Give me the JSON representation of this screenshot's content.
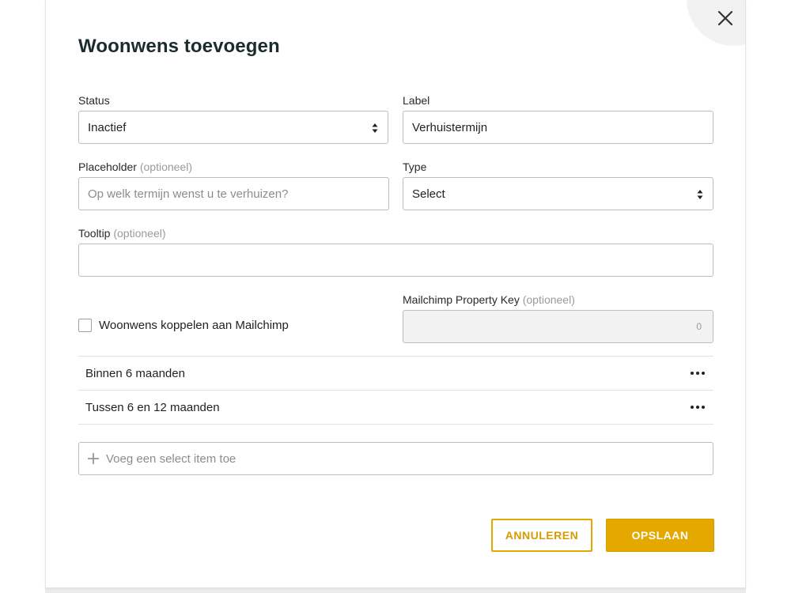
{
  "dialog": {
    "title": "Woonwens toevoegen"
  },
  "form": {
    "status": {
      "label": "Status",
      "value": "Inactief"
    },
    "label_field": {
      "label": "Label",
      "value": "Verhuistermijn"
    },
    "placeholder": {
      "label": "Placeholder",
      "optional": "(optioneel)",
      "placeholder": "Op welk termijn wenst u te verhuizen?"
    },
    "type": {
      "label": "Type",
      "value": "Select"
    },
    "tooltip": {
      "label": "Tooltip",
      "optional": "(optioneel)",
      "value": ""
    },
    "mailchimp_checkbox": {
      "label": "Woonwens koppelen aan Mailchimp",
      "checked": false
    },
    "mailchimp_key": {
      "label": "Mailchimp Property Key",
      "optional": "(optioneel)",
      "value": "0"
    }
  },
  "select_items": [
    {
      "label": "Binnen 6 maanden"
    },
    {
      "label": "Tussen 6 en 12 maanden"
    }
  ],
  "add_item": {
    "placeholder": "Voeg een select item toe"
  },
  "buttons": {
    "cancel": "ANNULEREN",
    "save": "OPSLAAN"
  },
  "icons": {
    "close": "close-icon",
    "select_arrows": "select-arrows-icon",
    "more": "more-horizontal-icon",
    "plus": "plus-icon"
  },
  "colors": {
    "accent": "#e4a800",
    "title": "#1c2b2b"
  }
}
